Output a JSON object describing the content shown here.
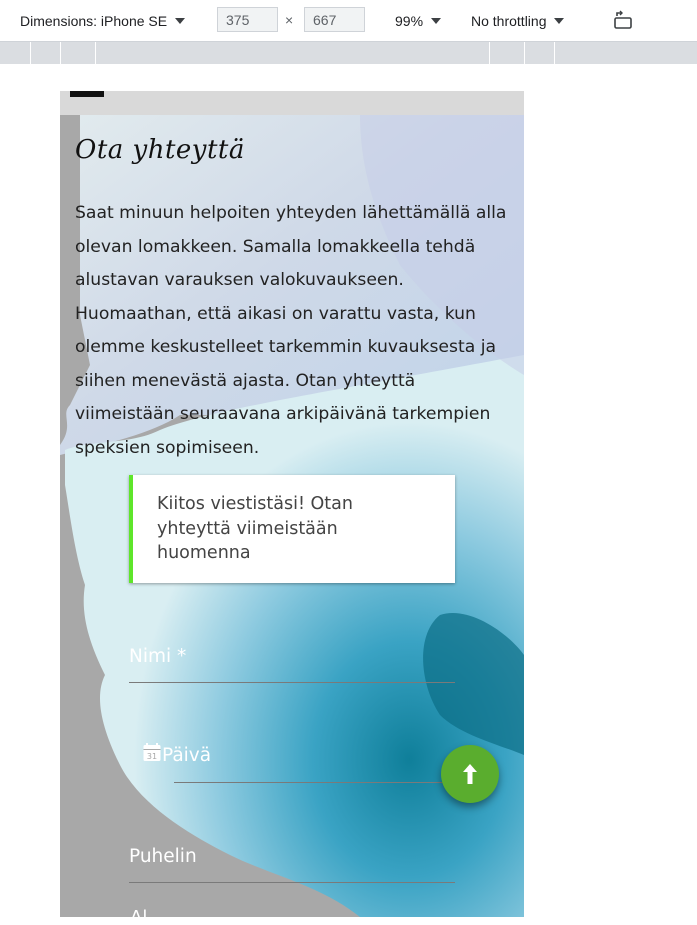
{
  "toolbar": {
    "dimensions_label": "Dimensions: iPhone SE",
    "width_value": "375",
    "times": "×",
    "height_value": "667",
    "zoom": "99%",
    "throttling": "No throttling"
  },
  "page": {
    "heading": "Ota yhteyttä",
    "intro": "Saat minuun helpoiten yhteyden lähettämällä alla olevan lomakkeen. Samalla lomakkeella tehdä alustavan varauksen valokuvaukseen. Huomaathan, että aikasi on varattu vasta, kun olemme keskustelleet tarkemmin kuvauksesta ja siihen menevästä ajasta. Otan yhteyttä viimeistään seuraavana arkipäivänä tarkempien speksien sopimiseen.",
    "notice": "Kiitos viestistäsi! Otan yhteyttä viimeistään huomenna",
    "form": {
      "name_label": "Nimi *",
      "date_label": "Päivä",
      "phone_label": "Puhelin",
      "cutoff_label": "Al"
    }
  },
  "icons": {
    "calendar": "calendar-icon",
    "scroll_top": "arrow-up-icon",
    "rotate": "rotate-icon"
  },
  "colors": {
    "accent_green": "#5aad2e",
    "notice_border": "#5ee62a"
  }
}
